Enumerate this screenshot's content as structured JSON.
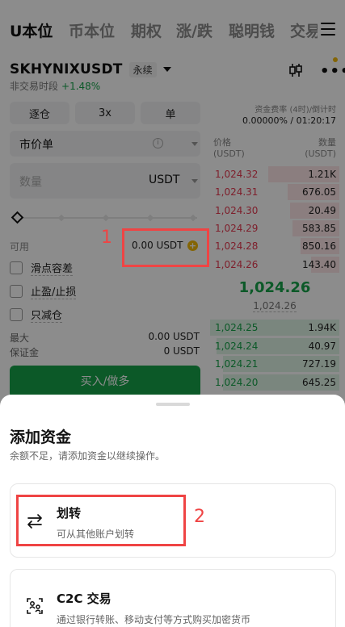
{
  "top_tabs": [
    "U本位",
    "币本位",
    "期权",
    "涨/跌",
    "聪明钱",
    "交易"
  ],
  "symbol": {
    "name": "SKHYNIXUSDT",
    "contract_type": "永续",
    "session_status": "非交易时段",
    "change_pct": "+1.48%"
  },
  "order_controls": {
    "margin_mode": "逐仓",
    "leverage": "3x",
    "position_mode": "单",
    "order_type": "市价单",
    "quantity_placeholder": "数量",
    "quantity_unit": "USDT",
    "available_label": "可用",
    "available_value": "0.00 USDT",
    "options": [
      "滑点容差",
      "止盈/止损",
      "只减仓"
    ],
    "max_label": "最大",
    "max_value": "0.00 USDT",
    "margin_label": "保证金",
    "margin_value": "0 USDT",
    "submit_label": "买入/做多"
  },
  "funding": {
    "label": "资金费率 (4时)/倒计时",
    "value": "0.00000% / 01:20:17"
  },
  "orderbook": {
    "price_header": "价格",
    "price_unit": "(USDT)",
    "amount_header": "数量",
    "amount_unit": "(USDT)",
    "asks": [
      {
        "price": "1,024.32",
        "amount": "1.21K",
        "depth": 0.55
      },
      {
        "price": "1,024.31",
        "amount": "676.05",
        "depth": 0.4
      },
      {
        "price": "1,024.30",
        "amount": "20.49",
        "depth": 0.38
      },
      {
        "price": "1,024.29",
        "amount": "583.85",
        "depth": 0.36
      },
      {
        "price": "1,024.28",
        "amount": "850.16",
        "depth": 0.3
      },
      {
        "price": "1,024.26",
        "amount": "143.40",
        "depth": 0.22
      }
    ],
    "last_price": "1,024.26",
    "mark_price": "1,024.26",
    "bids": [
      {
        "price": "1,024.25",
        "amount": "1.94K",
        "depth": 1.0
      },
      {
        "price": "1,024.24",
        "amount": "40.97",
        "depth": 0.95
      },
      {
        "price": "1,024.21",
        "amount": "727.19",
        "depth": 0.9
      },
      {
        "price": "1,024.20",
        "amount": "645.25",
        "depth": 0.9
      }
    ]
  },
  "annotations": [
    "1",
    "2"
  ],
  "sheet": {
    "title": "添加资金",
    "subtitle": "余额不足，请添加资金以继续操作。",
    "options": [
      {
        "title": "划转",
        "desc": "可从其他账户划转",
        "icon": "transfer-icon"
      },
      {
        "title": "C2C 交易",
        "desc": "通过银行转账、移动支付等方式购买加密货币",
        "icon": "c2c-icon"
      }
    ]
  },
  "colors": {
    "up": "#16a34a",
    "down": "#e53950",
    "accent": "#f0b90b",
    "annotation": "#ef4444"
  }
}
